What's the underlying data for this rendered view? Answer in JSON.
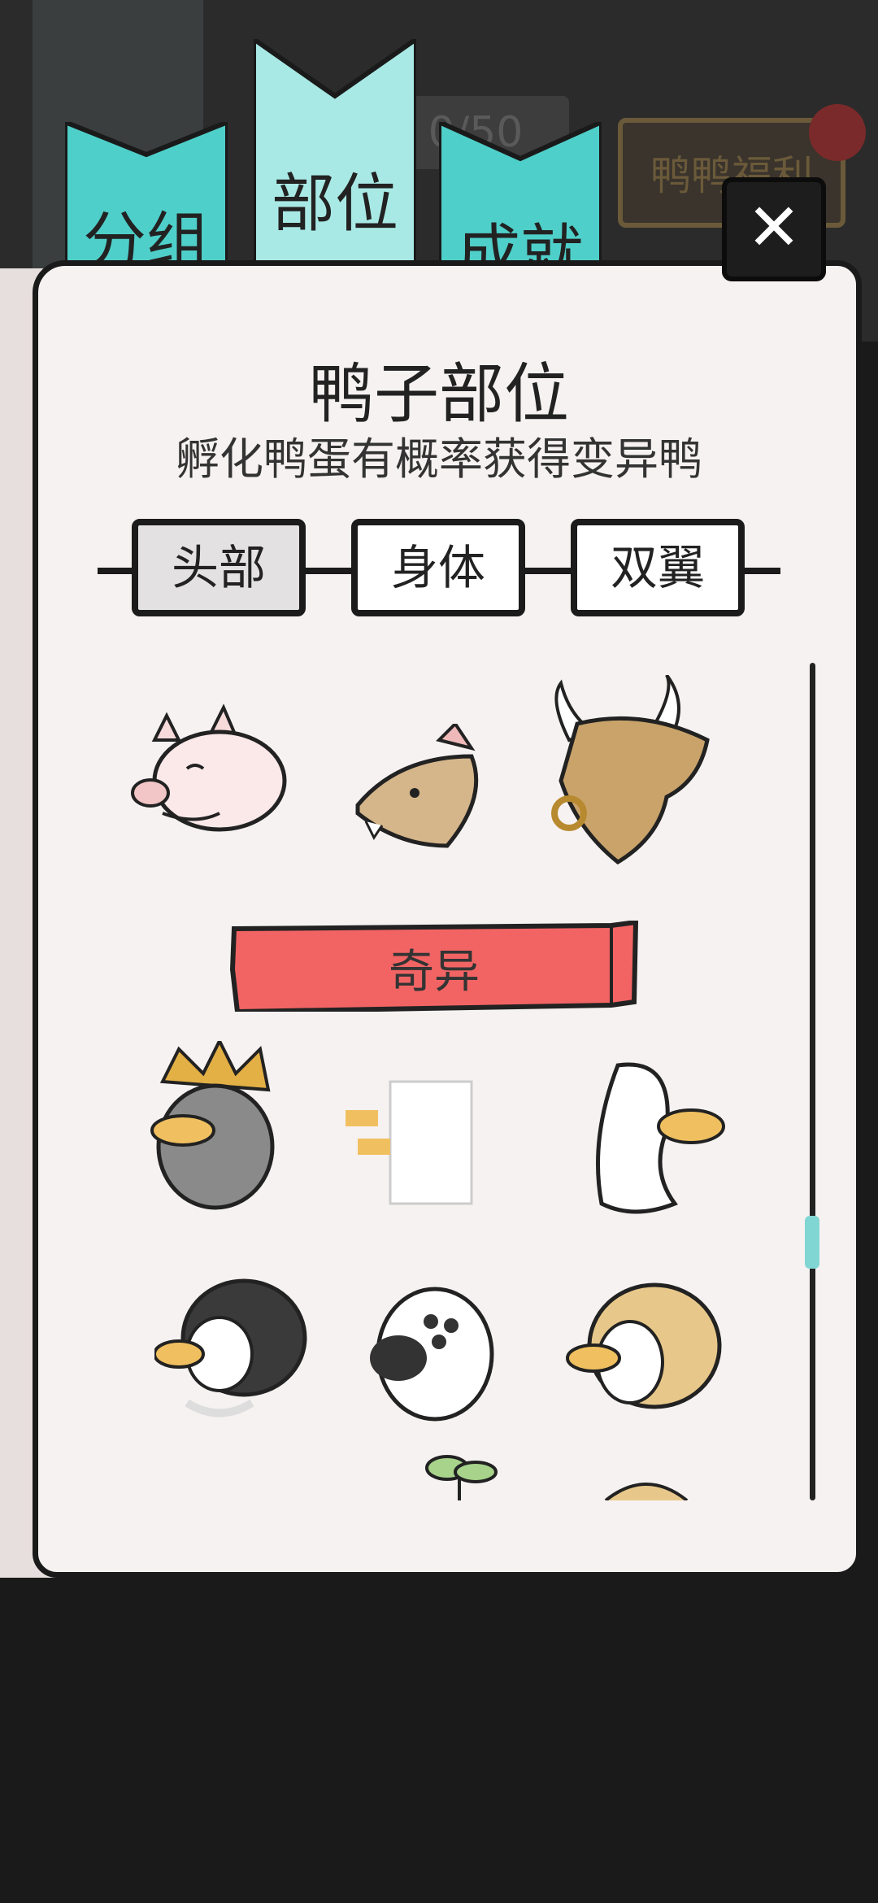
{
  "top_tabs": [
    {
      "label": "分组"
    },
    {
      "label": "部位"
    },
    {
      "label": "成就"
    }
  ],
  "hud": {
    "counter": "0/50",
    "welfare_label": "鸭鸭福利"
  },
  "close_label": "✕",
  "panel": {
    "title": "鸭子部位",
    "subtitle": "孵化鸭蛋有概率获得变异鸭"
  },
  "part_tabs": [
    {
      "label": "头部",
      "active": true
    },
    {
      "label": "身体",
      "active": false
    },
    {
      "label": "双翼",
      "active": false
    }
  ],
  "sections": {
    "rarity_label": "奇异"
  },
  "items_row1": [
    {
      "icon": "pig-head-icon"
    },
    {
      "icon": "rat-head-icon"
    },
    {
      "icon": "bull-head-icon"
    }
  ],
  "items_row2": [
    {
      "icon": "king-beard-head-icon"
    },
    {
      "icon": "ghost-pixel-head-icon"
    },
    {
      "icon": "ghost-sheet-head-icon"
    }
  ],
  "items_row3": [
    {
      "icon": "black-hair-pearl-head-icon"
    },
    {
      "icon": "three-eye-monster-head-icon"
    },
    {
      "icon": "blonde-wig-head-icon"
    }
  ],
  "colors": {
    "tab_teal": "#4fcfc9",
    "tab_teal_active": "#a9e9e5",
    "banner_red": "#f26464",
    "paper": "#f7f2f2",
    "scroll_thumb": "#7fd6d2"
  }
}
